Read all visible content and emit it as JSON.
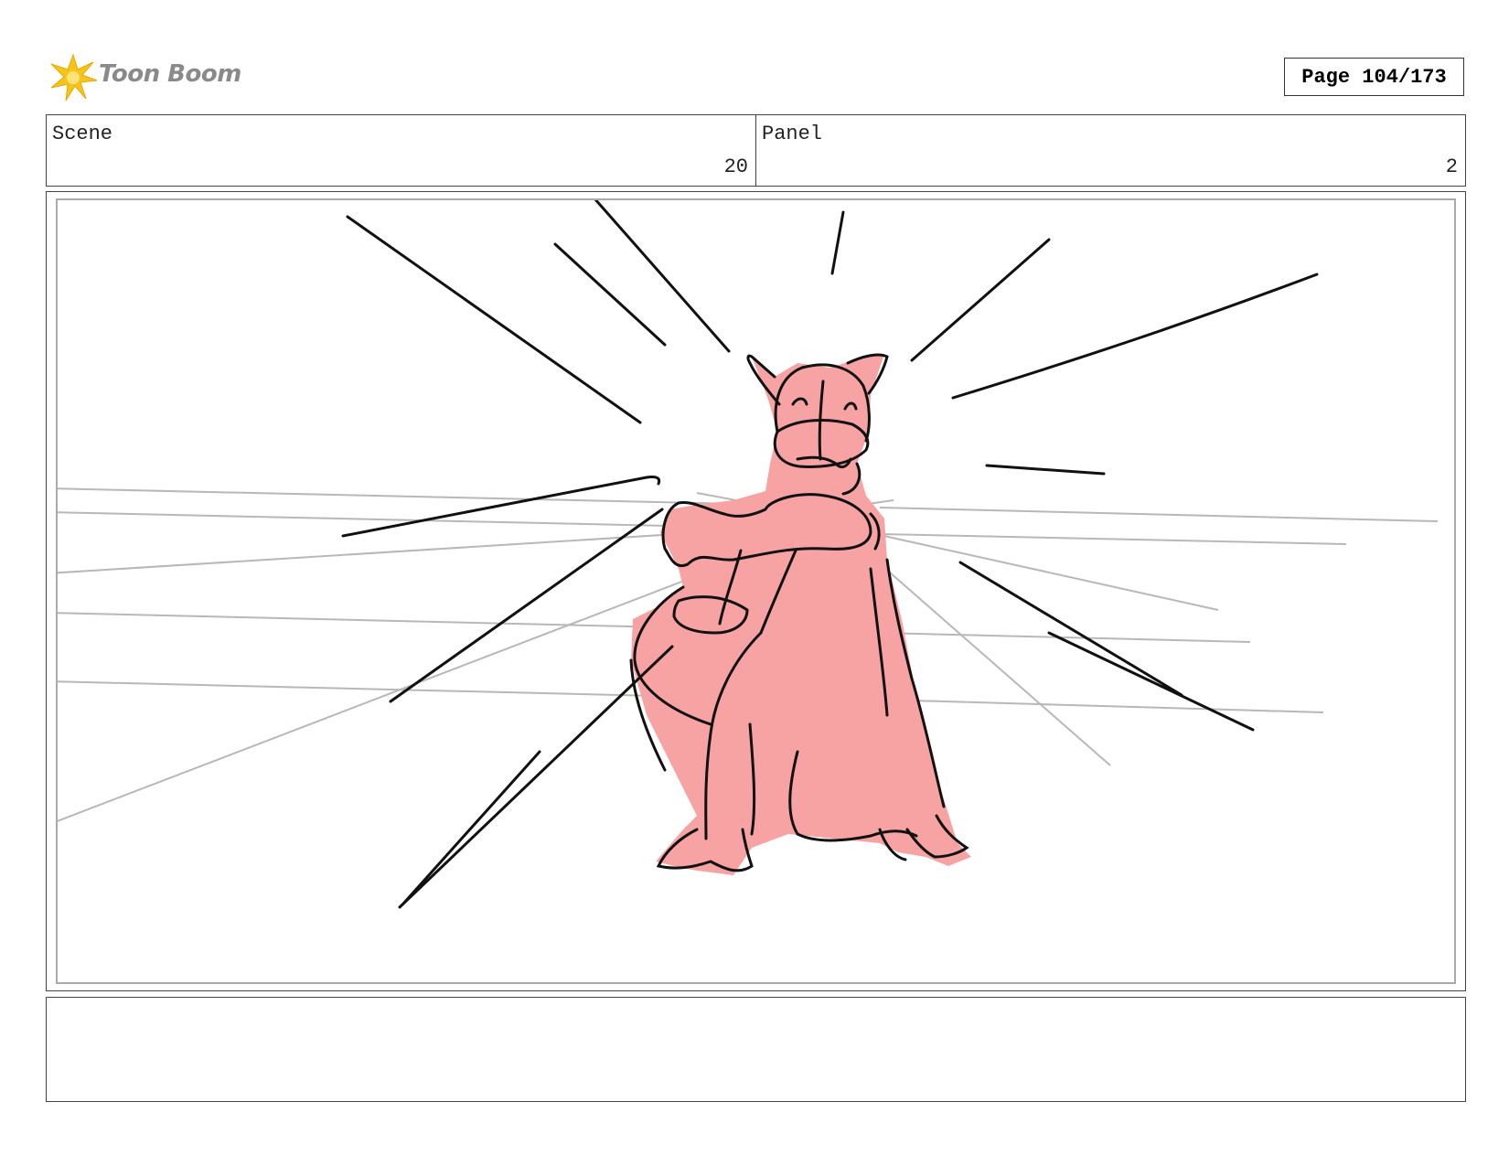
{
  "header": {
    "logo_text": "Toon Boom",
    "page_label": "Page 104/173"
  },
  "info": {
    "scene_label": "Scene",
    "scene_value": "20",
    "panel_label": "Panel",
    "panel_value": "2"
  },
  "colors": {
    "logo_star": "#f5c518",
    "character_fill": "#f7a3a3",
    "ink": "#111111",
    "guide_lines": "#b8b8b8"
  },
  "notes": {
    "text": ""
  }
}
